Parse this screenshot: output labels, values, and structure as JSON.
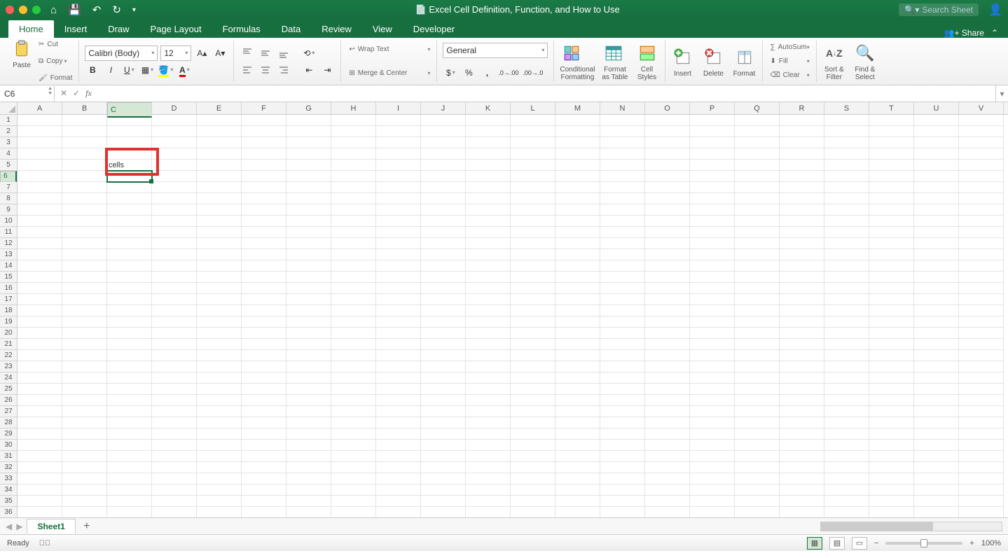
{
  "title": "Excel Cell Definition, Function, and How to Use",
  "search_placeholder": "Search Sheet",
  "tabs": [
    "Home",
    "Insert",
    "Draw",
    "Page Layout",
    "Formulas",
    "Data",
    "Review",
    "View",
    "Developer"
  ],
  "active_tab": "Home",
  "share_label": "Share",
  "ribbon": {
    "paste": "Paste",
    "cut": "Cut",
    "copy": "Copy",
    "format_painter": "Format",
    "font_name": "Calibri (Body)",
    "font_size": "12",
    "wrap": "Wrap Text",
    "merge": "Merge & Center",
    "number_format": "General",
    "cond_fmt": "Conditional\nFormatting",
    "fmt_table": "Format\nas Table",
    "cell_styles": "Cell\nStyles",
    "insert": "Insert",
    "delete": "Delete",
    "format": "Format",
    "autosum": "AutoSum",
    "fill": "Fill",
    "clear": "Clear",
    "sort": "Sort &\nFilter",
    "find": "Find &\nSelect"
  },
  "name_box": "C6",
  "formula": "",
  "columns": [
    "A",
    "B",
    "C",
    "D",
    "E",
    "F",
    "G",
    "H",
    "I",
    "J",
    "K",
    "L",
    "M",
    "N",
    "O",
    "P",
    "Q",
    "R",
    "S",
    "T",
    "U",
    "V"
  ],
  "row_count": 36,
  "selected_row": 6,
  "selected_col": "C",
  "highlighted_cell_value": "cells",
  "highlighted_cell": "C5",
  "sheet_name": "Sheet1",
  "status_text": "Ready",
  "zoom": "100%"
}
